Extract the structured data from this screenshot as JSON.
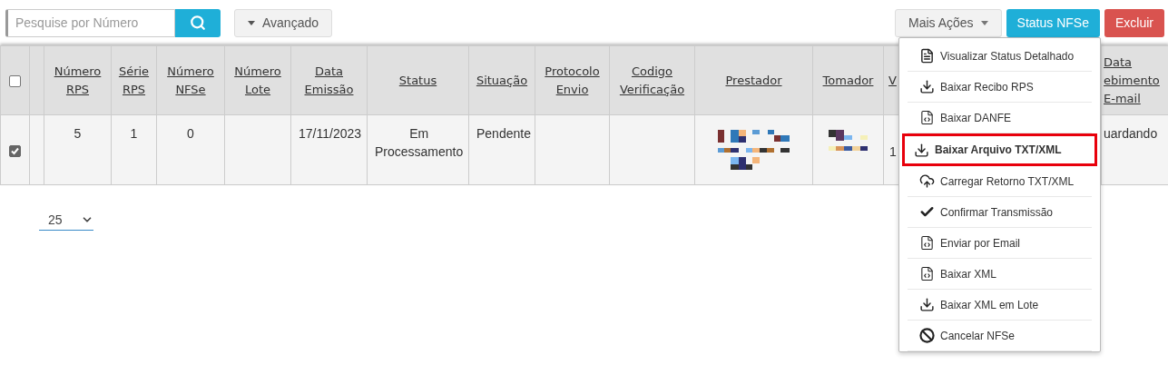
{
  "toolbar": {
    "search": {
      "placeholder": "Pesquise por Número"
    },
    "advanced_button": "Avançado",
    "more_actions_button": "Mais Ações",
    "status_button": "Status NFSe",
    "delete_button": "Excluir"
  },
  "table": {
    "header_checkbox": {
      "checked": false
    },
    "columns": [
      "Número\nRPS",
      "Série\nRPS",
      "Número\nNFSe",
      "Número\nLote",
      "Data\nEmissão",
      "Status",
      "Situação",
      "Protocolo\nEnvio",
      "Codigo\nVerificação",
      "Prestador",
      "Tomador",
      "V",
      "Data\nebimento\nE-mail"
    ],
    "rows": [
      {
        "checked": true,
        "cells": [
          "5",
          "1",
          "0",
          "",
          "17/11/2023",
          "Em Processamento",
          "Pendente",
          "",
          "",
          {
            "kind": "redacted"
          },
          {
            "kind": "redacted"
          },
          "1",
          "uardando"
        ]
      }
    ]
  },
  "page_size": "25",
  "menu": {
    "items": [
      {
        "kind": "details",
        "label": "Visualizar Status Detalhado",
        "highlighted": false
      },
      {
        "kind": "download",
        "label": "Baixar Recibo RPS",
        "highlighted": false
      },
      {
        "kind": "code-file",
        "label": "Baixar DANFE",
        "highlighted": false
      },
      {
        "kind": "download",
        "label": "Baixar Arquivo TXT/XML",
        "highlighted": true
      },
      {
        "kind": "upload",
        "label": "Carregar Retorno TXT/XML",
        "highlighted": false
      },
      {
        "kind": "check",
        "label": "Confirmar Transmissão",
        "highlighted": false
      },
      {
        "kind": "code-file",
        "label": "Enviar por Email",
        "highlighted": false
      },
      {
        "kind": "code-file",
        "label": "Baixar XML",
        "highlighted": false
      },
      {
        "kind": "download",
        "label": "Baixar XML em Lote",
        "highlighted": false
      },
      {
        "kind": "ban",
        "label": "Cancelar NFSe",
        "highlighted": false
      }
    ]
  }
}
